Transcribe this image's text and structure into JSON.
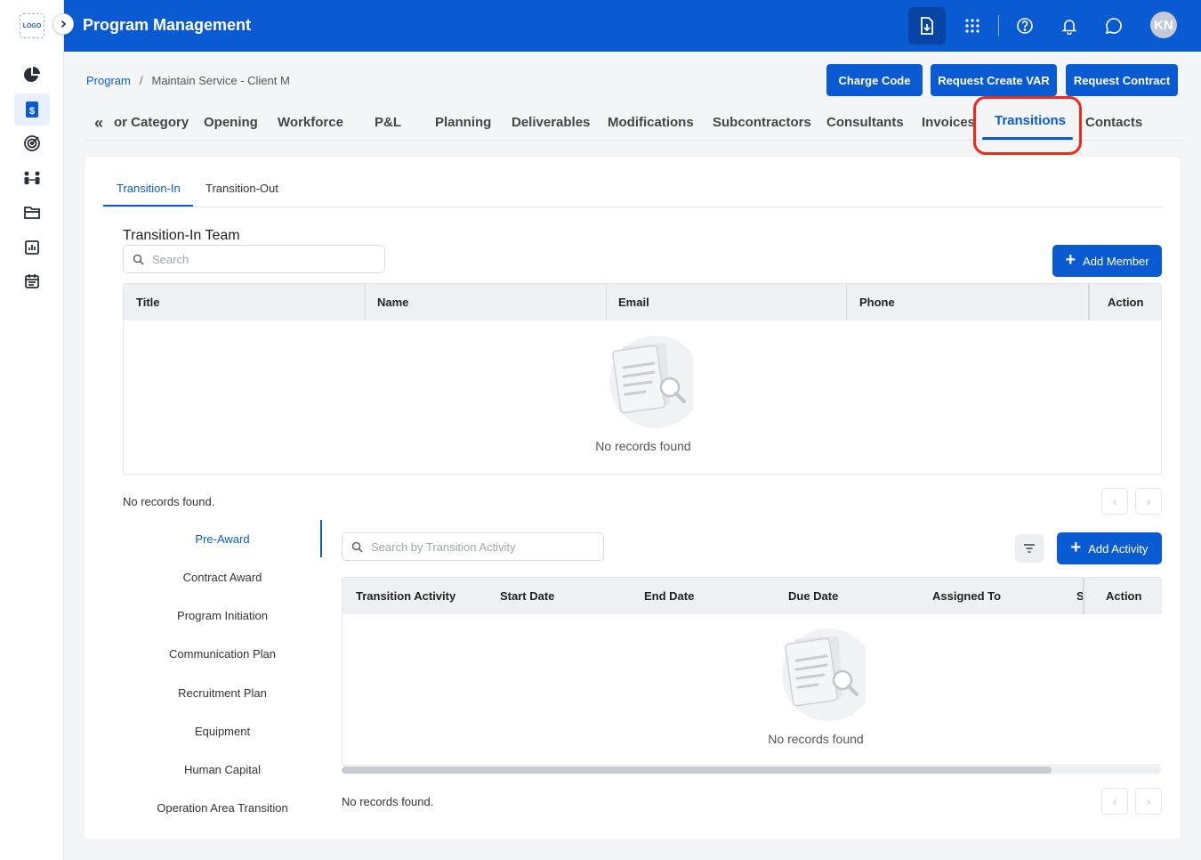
{
  "app": {
    "title": "Program Management",
    "logo_text": "LOGO",
    "avatar_initials": "KN"
  },
  "breadcrumb": {
    "root": "Program",
    "separator": "/",
    "current": "Maintain Service - Client M"
  },
  "actions": {
    "charge_code": "Charge Code",
    "request_var": "Request Create VAR",
    "request_contract": "Request Contract"
  },
  "module_tabs": {
    "back_icon": "«",
    "items": [
      "or Category",
      "Opening",
      "Workforce",
      "P&L",
      "Planning",
      "Deliverables",
      "Modifications",
      "Subcontractors",
      "Consultants",
      "Invoices",
      "Transitions",
      "Contacts"
    ],
    "active": "Transitions"
  },
  "sub_tabs": {
    "items": [
      "Transition-In",
      "Transition-Out"
    ],
    "active": "Transition-In"
  },
  "team": {
    "title": "Transition-In Team",
    "search_placeholder": "Search",
    "add_label": "Add Member",
    "columns": [
      "Title",
      "Name",
      "Email",
      "Phone",
      "Action"
    ],
    "empty_text": "No records found",
    "records_text": "No records found."
  },
  "phases": {
    "items": [
      "Pre-Award",
      "Contract Award",
      "Program Initiation",
      "Communication Plan",
      "Recruitment Plan",
      "Equipment",
      "Human Capital",
      "Operation Area Transition"
    ],
    "active": "Pre-Award"
  },
  "activities": {
    "search_placeholder": "Search by Transition Activity",
    "add_label": "Add Activity",
    "columns": [
      "Transition Activity",
      "Start Date",
      "End Date",
      "Due Date",
      "Assigned To",
      "S",
      "Action"
    ],
    "empty_text": "No records found",
    "records_text": "No records found."
  },
  "colors": {
    "primary": "#0a5ad1",
    "highlight": "#f0291a",
    "header_bg": "#0a5ad1"
  }
}
